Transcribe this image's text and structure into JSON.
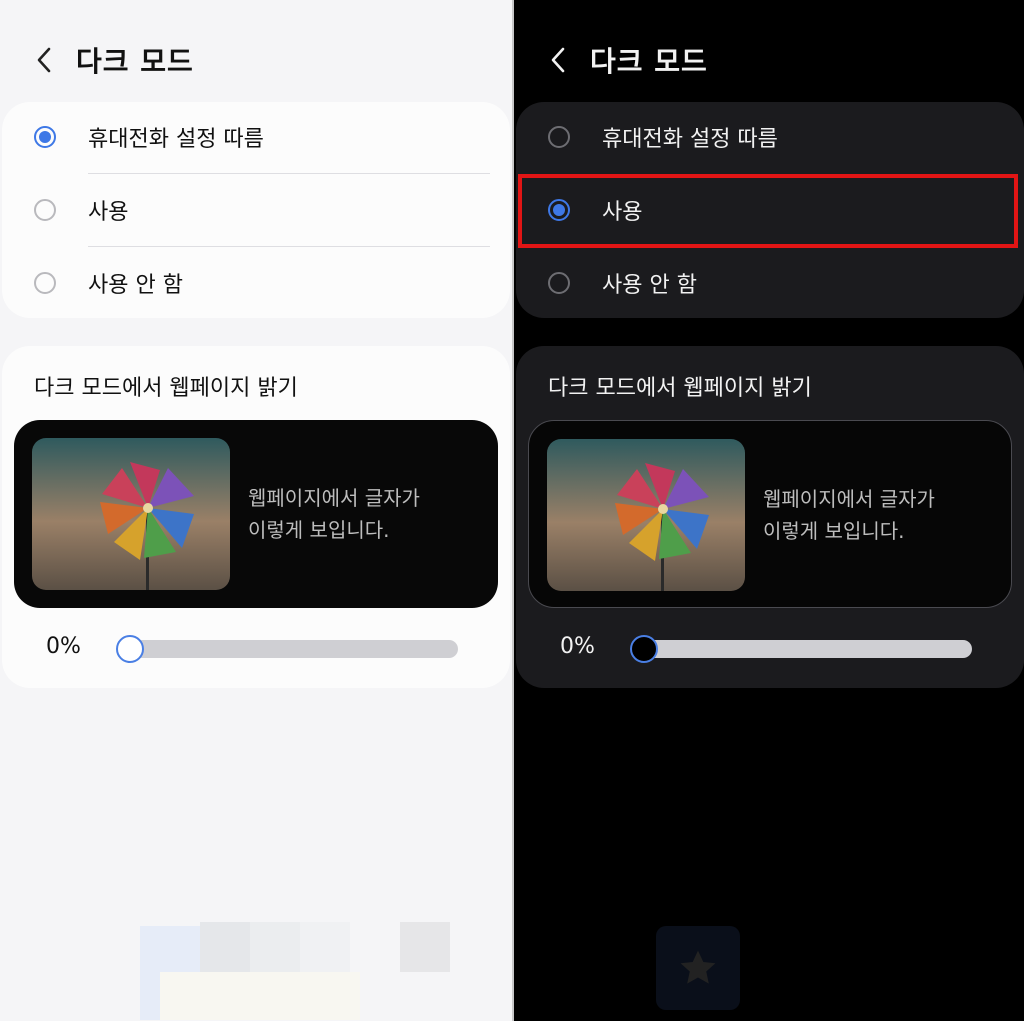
{
  "screen_title": "다크 모드",
  "options": [
    "휴대전화 설정 따름",
    "사용",
    "사용 안 함"
  ],
  "section_title": "다크 모드에서 웹페이지 밝기",
  "preview_text_line1": "웹페이지에서 글자가",
  "preview_text_line2": "이렇게 보입니다.",
  "brightness_label": "0%",
  "brightness_value": 0,
  "left_panel": {
    "theme": "light",
    "selected_option": "휴대전화 설정 따름"
  },
  "right_panel": {
    "theme": "dark",
    "selected_option": "사용",
    "highlighted_option": "사용"
  },
  "colors": {
    "accent": "#3e78e6",
    "highlight": "#e21515"
  },
  "icons": {
    "back": "chevron-left-icon",
    "favorite": "star-icon"
  }
}
